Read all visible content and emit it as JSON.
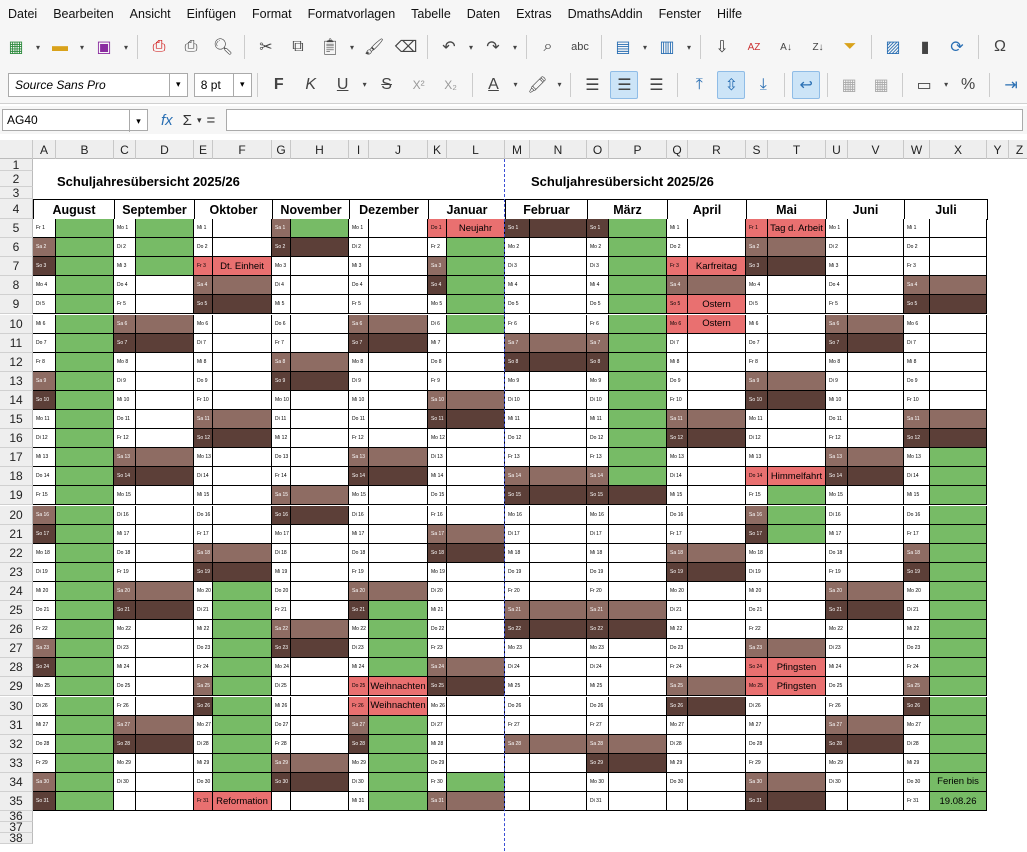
{
  "menu": [
    "Datei",
    "Bearbeiten",
    "Ansicht",
    "Einfügen",
    "Format",
    "Formatvorlagen",
    "Tabelle",
    "Daten",
    "Extras",
    "DmathsAddin",
    "Fenster",
    "Hilfe"
  ],
  "font": {
    "name": "Source Sans Pro",
    "size": "8 pt"
  },
  "namebox": "AG40",
  "colors": {
    "green": "#77bb66",
    "brown_light": "#8e6c63",
    "brown_dark": "#5c3f38",
    "red": "#e97070"
  },
  "sheet": {
    "columns": [
      "A",
      "B",
      "C",
      "D",
      "E",
      "F",
      "G",
      "H",
      "I",
      "J",
      "K",
      "L",
      "M",
      "N",
      "O",
      "P",
      "Q",
      "R",
      "S",
      "T",
      "U",
      "V",
      "W",
      "X",
      "Y",
      "Z"
    ],
    "rows": [
      "1",
      "2",
      "3",
      "4",
      "5",
      "6",
      "7",
      "8",
      "9",
      "10",
      "11",
      "12",
      "13",
      "14",
      "15",
      "16",
      "17",
      "18",
      "19",
      "20",
      "21",
      "22",
      "23",
      "24",
      "25",
      "26",
      "27",
      "28",
      "29",
      "30",
      "31",
      "32",
      "33",
      "34",
      "35",
      "36",
      "37",
      "38"
    ],
    "title_left": "Schuljahresübersicht 2025/26",
    "title_right": "Schuljahresübersicht 2025/26"
  },
  "months": [
    {
      "name": "August",
      "start": "Fr",
      "days": 31
    },
    {
      "name": "September",
      "start": "Mo",
      "days": 30
    },
    {
      "name": "Oktober",
      "start": "Mi",
      "days": 31
    },
    {
      "name": "November",
      "start": "Sa",
      "days": 30
    },
    {
      "name": "Dezember",
      "start": "Mo",
      "days": 31
    },
    {
      "name": "Januar",
      "start": "Do",
      "days": 31
    },
    {
      "name": "Februar",
      "start": "So",
      "days": 28
    },
    {
      "name": "März",
      "start": "So",
      "days": 31
    },
    {
      "name": "April",
      "start": "Mi",
      "days": 30
    },
    {
      "name": "Mai",
      "start": "Fr",
      "days": 31
    },
    {
      "name": "Juni",
      "start": "Mo",
      "days": 30
    },
    {
      "name": "Juli",
      "start": "Mi",
      "days": 31
    }
  ],
  "holidays": [
    {
      "month": 2,
      "day": 3,
      "label": "Dt. Einheit"
    },
    {
      "month": 2,
      "day": 31,
      "label": "Reformation"
    },
    {
      "month": 4,
      "day": 25,
      "label": "Weihnachten"
    },
    {
      "month": 4,
      "day": 26,
      "label": "Weihnachten"
    },
    {
      "month": 5,
      "day": 1,
      "label": "Neujahr"
    },
    {
      "month": 8,
      "day": 3,
      "label": "Karfreitag"
    },
    {
      "month": 8,
      "day": 5,
      "label": "Ostern"
    },
    {
      "month": 8,
      "day": 6,
      "label": "Ostern"
    },
    {
      "month": 9,
      "day": 1,
      "label": "Tag d. Arbeit"
    },
    {
      "month": 9,
      "day": 14,
      "label": "Himmelfahrt"
    },
    {
      "month": 9,
      "day": 24,
      "label": "Pfingsten"
    },
    {
      "month": 9,
      "day": 25,
      "label": "Pfingsten"
    }
  ],
  "vacations": [
    {
      "month": 0,
      "from": 1,
      "to": 31
    },
    {
      "month": 1,
      "from": 1,
      "to": 3
    },
    {
      "month": 2,
      "from": 20,
      "to": 31
    },
    {
      "month": 3,
      "from": 1,
      "to": 1
    },
    {
      "month": 4,
      "from": 21,
      "to": 31
    },
    {
      "month": 5,
      "from": 1,
      "to": 6
    },
    {
      "month": 5,
      "from": 30,
      "to": 30
    },
    {
      "month": 7,
      "from": 1,
      "to": 14
    },
    {
      "month": 9,
      "from": 15,
      "to": 17
    },
    {
      "month": 11,
      "from": 13,
      "to": 31
    }
  ],
  "july_note": [
    "Ferien bis",
    "19.08.26"
  ]
}
